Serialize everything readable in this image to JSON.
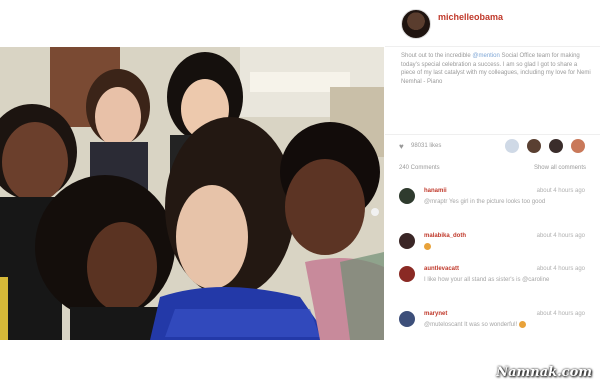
{
  "header": {
    "username": "michelleobama"
  },
  "caption": {
    "line1": "Shout out to the incredible ",
    "mention1": "@mention",
    "line2": " Social Office team for making today's special celebration a success. I am so glad I got to share a piece of my last catalyst with my colleagues, including my love for Nemi Nemhal ",
    "line3": "- Piano"
  },
  "stats": {
    "likes": "98031 likes",
    "comments_count": "240 Comments",
    "show_all": "Show all comments"
  },
  "comments": [
    {
      "user": "hanamii",
      "time": "about 4 hours ago",
      "text": "@mraptr Yes girl in the picture looks too good",
      "avatar_color": "#2f3b2e"
    },
    {
      "user": "malabika_doth",
      "time": "about 4 hours ago",
      "text": "",
      "avatar_color": "#3a2626",
      "emoji": true
    },
    {
      "user": "auntlevacatt",
      "time": "about 4 hours ago",
      "text": "I like how your all stand as sister's is @caroline",
      "avatar_color": "#8a2a24"
    },
    {
      "user": "marynet",
      "time": "about 4 hours ago",
      "text": "@muteloscant It was so wonderful!",
      "avatar_color": "#3d4f7a",
      "emoji": true
    }
  ],
  "like_faces": [
    "#cfd9e6",
    "#5a4032",
    "#3a2d2b",
    "#c9795a"
  ],
  "watermark": "Namnak.com"
}
